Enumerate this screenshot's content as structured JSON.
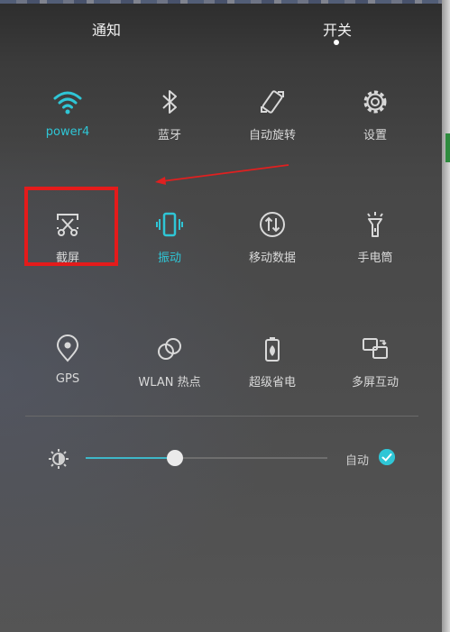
{
  "header": {
    "tab_notify": "通知",
    "tab_switch": "开关"
  },
  "tiles": [
    {
      "label": "power4",
      "icon": "wifi-icon",
      "active": true
    },
    {
      "label": "蓝牙",
      "icon": "bluetooth-icon",
      "active": false
    },
    {
      "label": "自动旋转",
      "icon": "auto-rotate-icon",
      "active": false
    },
    {
      "label": "设置",
      "icon": "settings-gear-icon",
      "active": false
    },
    {
      "label": "截屏",
      "icon": "screenshot-scissors-icon",
      "active": false
    },
    {
      "label": "振动",
      "icon": "vibrate-icon",
      "active": true
    },
    {
      "label": "移动数据",
      "icon": "mobile-data-icon",
      "active": false
    },
    {
      "label": "手电筒",
      "icon": "flashlight-icon",
      "active": false
    },
    {
      "label": "GPS",
      "icon": "location-pin-icon",
      "active": false
    },
    {
      "label": "WLAN 热点",
      "icon": "hotspot-icon",
      "active": false
    },
    {
      "label": "超级省电",
      "icon": "battery-saver-icon",
      "active": false
    },
    {
      "label": "多屏互动",
      "icon": "multi-screen-icon",
      "active": false
    }
  ],
  "brightness": {
    "level": 0.37,
    "auto_label": "自动",
    "auto_checked": true,
    "icon": "brightness-sun-icon"
  },
  "colors": {
    "accent": "#2fc6d6",
    "annotation": "#e41b1b",
    "icon": "#d9d9d9"
  }
}
